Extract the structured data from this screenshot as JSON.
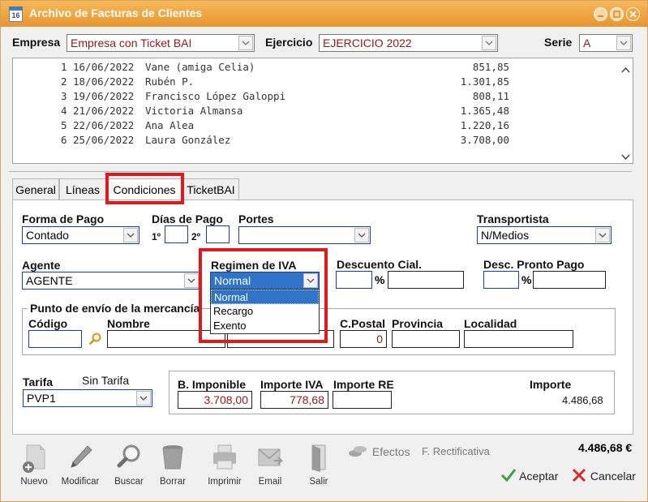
{
  "window": {
    "title": "Archivo de Facturas de Clientes",
    "icon_text": "16"
  },
  "header": {
    "empresa_label": "Empresa",
    "empresa_value": "Empresa con Ticket BAI",
    "ejercicio_label": "Ejercicio",
    "ejercicio_value": "EJERCICIO 2022",
    "serie_label": "Serie",
    "serie_value": "A"
  },
  "invoice_list": [
    {
      "num": "1",
      "date": "16/06/2022",
      "client": "Vane (amiga Celia)",
      "amount": "851,85"
    },
    {
      "num": "2",
      "date": "18/06/2022",
      "client": "Rubén P.",
      "amount": "1.301,85"
    },
    {
      "num": "3",
      "date": "19/06/2022",
      "client": "Francisco López Galoppi",
      "amount": "808,11"
    },
    {
      "num": "4",
      "date": "21/06/2022",
      "client": "Victoria Almansa",
      "amount": "1.365,48"
    },
    {
      "num": "5",
      "date": "22/06/2022",
      "client": "Ana Alea",
      "amount": "1.220,16"
    },
    {
      "num": "6",
      "date": "25/06/2022",
      "client": "Laura González",
      "amount": "3.708,00"
    }
  ],
  "tabs": [
    {
      "label": "General"
    },
    {
      "label": "Líneas"
    },
    {
      "label": "Condiciones"
    },
    {
      "label": "TicketBAI"
    }
  ],
  "conditions": {
    "forma_pago_label": "Forma de Pago",
    "forma_pago_value": "Contado",
    "dias_pago_label": "Días de Pago",
    "dia1_label": "1º",
    "dia2_label": "2º",
    "portes_label": "Portes",
    "portes_value": "",
    "transportista_label": "Transportista",
    "transportista_value": "N/Medios",
    "agente_label": "Agente",
    "agente_value": "AGENTE",
    "regimen_label": "Regimen de IVA",
    "regimen_value": "Normal",
    "regimen_options": [
      "Normal",
      "Recargo",
      "Exento"
    ],
    "descuento_label": "Descuento Cial.",
    "pronto_pago_label": "Desc. Pronto Pago",
    "pct_symbol": "%",
    "envio_group_label": "Punto de envío de la mercancía",
    "codigo_label": "Código",
    "nombre_label": "Nombre",
    "cpostal_label": "C.Postal",
    "cpostal_value": "0",
    "provincia_label": "Provincia",
    "localidad_label": "Localidad",
    "tarifa_label": "Tarifa",
    "tarifa_desc": "Sin Tarifa",
    "tarifa_value": "PVP1"
  },
  "totals": {
    "base_label": "B. Imponible",
    "base_value": "3.708,00",
    "iva_label": "Importe IVA",
    "iva_value": "778,68",
    "re_label": "Importe RE",
    "re_value": "",
    "importe_label": "Importe",
    "importe_value": "4.486,68",
    "grand_total": "4.486,68 €"
  },
  "toolbar": {
    "nuevo": "Nuevo",
    "modificar": "Modificar",
    "buscar": "Buscar",
    "borrar": "Borrar",
    "imprimir": "Imprimir",
    "email": "Email",
    "salir": "Salir",
    "efectos": "Efectos",
    "rectificativa": "F. Rectificativa",
    "aceptar": "Aceptar",
    "cancelar": "Cancelar"
  },
  "colors": {
    "titlebar": "#f0a543",
    "highlight": "#e0191f",
    "selection": "#2f74c9",
    "field_border_blue": "#1e3c9e",
    "money_red": "#8b1a1a"
  }
}
